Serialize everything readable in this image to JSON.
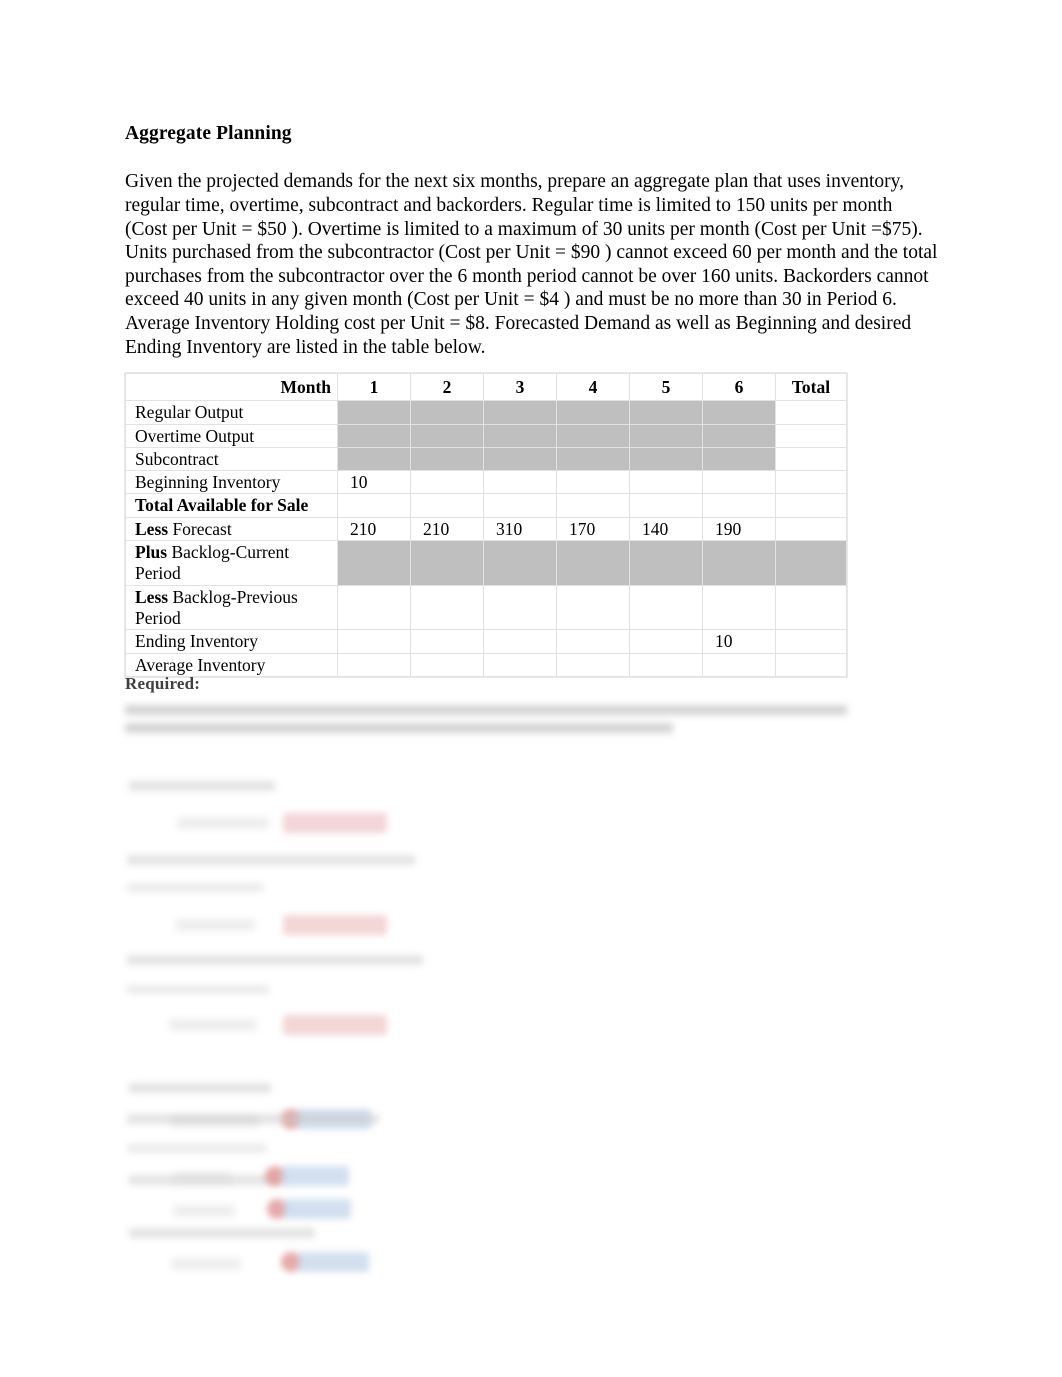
{
  "document": {
    "title": "Aggregate Planning",
    "intro_paragraph": "Given the projected demands for the next six months, prepare an aggregate plan that uses inventory, regular time, overtime, subcontract and backorders. Regular time is limited to 150 units per month (Cost per Unit = $50 ). Overtime is limited to a maximum of 30 units per month (Cost per Unit =$75). Units purchased from the subcontractor (Cost per Unit = $90 ) cannot exceed 60 per month and the total purchases from the subcontractor over the 6 month period cannot be over 160 units. Backorders cannot exceed 40 units in any given month (Cost per Unit = $4 ) and must be no more than 30 in Period 6. Average Inventory Holding cost per Unit = $8. Forecasted Demand as well as Beginning and desired Ending Inventory are listed in the table below.",
    "required_label": "Required:"
  },
  "table": {
    "corner_label": "Month",
    "columns": [
      "1",
      "2",
      "3",
      "4",
      "5",
      "6"
    ],
    "total_column": "Total",
    "rows": [
      {
        "label_bold_prefix": "",
        "label": "Regular Output",
        "all_bold": false,
        "two_line": false,
        "shaded": true,
        "total_shaded": false,
        "values": [
          "",
          "",
          "",
          "",
          "",
          ""
        ],
        "total": ""
      },
      {
        "label_bold_prefix": "",
        "label": "Overtime Output",
        "all_bold": false,
        "two_line": false,
        "shaded": true,
        "total_shaded": false,
        "values": [
          "",
          "",
          "",
          "",
          "",
          ""
        ],
        "total": ""
      },
      {
        "label_bold_prefix": "",
        "label": "Subcontract",
        "all_bold": false,
        "two_line": false,
        "shaded": true,
        "total_shaded": false,
        "values": [
          "",
          "",
          "",
          "",
          "",
          ""
        ],
        "total": ""
      },
      {
        "label_bold_prefix": "",
        "label": "Beginning Inventory",
        "all_bold": false,
        "two_line": false,
        "shaded": false,
        "total_shaded": false,
        "values": [
          "10",
          "",
          "",
          "",
          "",
          ""
        ],
        "total": ""
      },
      {
        "label_bold_prefix": "",
        "label": "Total Available for Sale",
        "all_bold": true,
        "two_line": false,
        "shaded": false,
        "total_shaded": false,
        "values": [
          "",
          "",
          "",
          "",
          "",
          ""
        ],
        "total": ""
      },
      {
        "label_bold_prefix": "Less",
        "label": " Forecast",
        "all_bold": false,
        "two_line": false,
        "shaded": false,
        "total_shaded": false,
        "values": [
          "210",
          "210",
          "310",
          "170",
          "140",
          "190"
        ],
        "total": ""
      },
      {
        "label_bold_prefix": "Plus",
        "label": " Backlog-Current Period",
        "all_bold": false,
        "two_line": true,
        "shaded": true,
        "total_shaded": true,
        "values": [
          "",
          "",
          "",
          "",
          "",
          ""
        ],
        "total": ""
      },
      {
        "label_bold_prefix": "Less",
        "label": " Backlog-Previous Period",
        "all_bold": false,
        "two_line": true,
        "shaded": false,
        "total_shaded": false,
        "values": [
          "",
          "",
          "",
          "",
          "",
          ""
        ],
        "total": ""
      },
      {
        "label_bold_prefix": "",
        "label": "Ending Inventory",
        "all_bold": false,
        "two_line": false,
        "shaded": false,
        "total_shaded": false,
        "values": [
          "",
          "",
          "",
          "",
          "",
          "10"
        ],
        "total": ""
      },
      {
        "label_bold_prefix": "",
        "label": "Average Inventory",
        "all_bold": false,
        "two_line": false,
        "shaded": false,
        "total_shaded": false,
        "values": [
          "",
          "",
          "",
          "",
          "",
          ""
        ],
        "total": ""
      }
    ]
  },
  "colors": {
    "shaded_cell": "#bfbfbf",
    "table_border": "#e2e2e2",
    "required_text": "#3f3f3f",
    "redacted_text": "#c9c9c9",
    "redacted_highlight_red": "#eec3c3",
    "redacted_highlight_blue": "#bcd0e8",
    "redacted_marker_red": "#e08c8c"
  }
}
